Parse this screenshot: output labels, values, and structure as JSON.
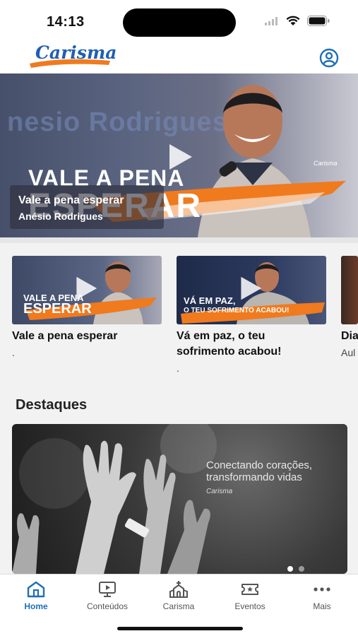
{
  "status_bar": {
    "time": "14:13"
  },
  "app_bar": {
    "logo_text": "Carisma"
  },
  "hero": {
    "background_text": "nesio Rodrigues",
    "title_line1": "VALE A PENA",
    "title_line2": "ESPERAR",
    "caption_title": "Vale a pena esperar",
    "caption_subtitle": "Anésio Rodrigues",
    "brand": "Carisma"
  },
  "carousel": [
    {
      "title": "Vale a pena esperar",
      "subtitle": ".",
      "thumb_line1": "VALE A PENA",
      "thumb_line2": "ESPERAR"
    },
    {
      "title": "Vá em paz, o teu sofrimento acabou!",
      "subtitle": ".",
      "thumb_line1": "VÁ EM PAZ,",
      "thumb_line2": "O TEU SOFRIMENTO ACABOU!"
    },
    {
      "title": "Dia CO",
      "subtitle": "Aul"
    }
  ],
  "highlights": {
    "section_title": "Destaques",
    "tagline": "Conectando corações, transformando vidas",
    "brand": "Carisma",
    "page_indicator": {
      "count": 2,
      "active": 0
    }
  },
  "tabs": [
    {
      "label": "Home",
      "icon": "home-icon",
      "active": true
    },
    {
      "label": "Conteúdos",
      "icon": "monitor-play-icon",
      "active": false
    },
    {
      "label": "Carisma",
      "icon": "church-icon",
      "active": false
    },
    {
      "label": "Eventos",
      "icon": "ticket-icon",
      "active": false
    },
    {
      "label": "Mais",
      "icon": "more-dots-icon",
      "active": false
    }
  ],
  "colors": {
    "accent": "#1f6fb8",
    "brand_orange": "#f07a1e",
    "logo_blue": "#1f5fb4"
  }
}
